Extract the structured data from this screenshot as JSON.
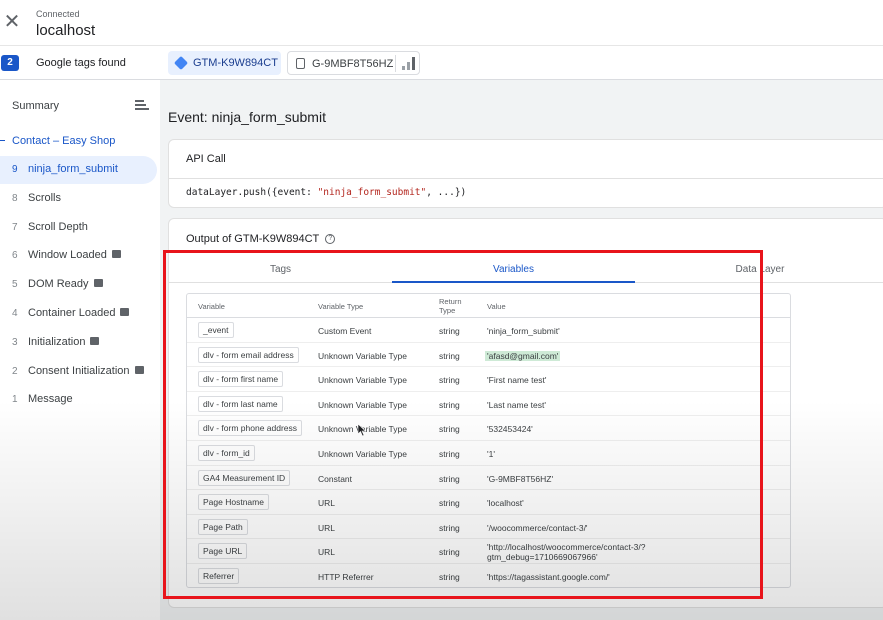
{
  "header": {
    "status": "Connected",
    "host": "localhost"
  },
  "tagbar": {
    "count": "2",
    "found_label": "Google tags found",
    "gtm_chip": "GTM-K9W894CT",
    "ga_chip": "G-9MBF8T56HZ"
  },
  "sidebar": {
    "summary": "Summary",
    "page_group": "Contact – Easy Shop",
    "events": [
      {
        "num": "9",
        "name": "ninja_form_submit",
        "icon": false
      },
      {
        "num": "8",
        "name": "Scrolls",
        "icon": false
      },
      {
        "num": "7",
        "name": "Scroll Depth",
        "icon": false
      },
      {
        "num": "6",
        "name": "Window Loaded",
        "icon": true
      },
      {
        "num": "5",
        "name": "DOM Ready",
        "icon": true
      },
      {
        "num": "4",
        "name": "Container Loaded",
        "icon": true
      },
      {
        "num": "3",
        "name": "Initialization",
        "icon": true
      },
      {
        "num": "2",
        "name": "Consent Initialization",
        "icon": true
      },
      {
        "num": "1",
        "name": "Message",
        "icon": false
      }
    ]
  },
  "main": {
    "event_title": "Event: ninja_form_submit",
    "api_card": {
      "title": "API Call",
      "code_prefix": "dataLayer.push({event: ",
      "code_string": "\"ninja_form_submit\"",
      "code_suffix": ", ...})"
    },
    "output": {
      "title": "Output of GTM-K9W894CT",
      "tabs": [
        "Tags",
        "Variables",
        "Data Layer"
      ],
      "active_tab": "Variables"
    },
    "table": {
      "headers": [
        "Variable",
        "Variable Type",
        "Return",
        "Type",
        "Value"
      ],
      "rows": [
        {
          "name": "_event",
          "type": "Custom Event",
          "ret": "string",
          "value": "'ninja_form_submit'"
        },
        {
          "name": "dlv - form email address",
          "type": "Unknown Variable Type",
          "ret": "string",
          "value": "'afasd@gmail.com'"
        },
        {
          "name": "dlv - form first name",
          "type": "Unknown Variable Type",
          "ret": "string",
          "value": "'First name test'"
        },
        {
          "name": "dlv - form last name",
          "type": "Unknown Variable Type",
          "ret": "string",
          "value": "'Last name test'"
        },
        {
          "name": "dlv - form phone address",
          "type": "Unknown Variable Type",
          "ret": "string",
          "value": "'532453424'"
        },
        {
          "name": "dlv - form_id",
          "type": "Unknown Variable Type",
          "ret": "string",
          "value": "'1'"
        },
        {
          "name": "GA4 Measurement ID",
          "type": "Constant",
          "ret": "string",
          "value": "'G-9MBF8T56HZ'"
        },
        {
          "name": "Page Hostname",
          "type": "URL",
          "ret": "string",
          "value": "'localhost'"
        },
        {
          "name": "Page Path",
          "type": "URL",
          "ret": "string",
          "value": "'/woocommerce/contact-3/'"
        },
        {
          "name": "Page URL",
          "type": "URL",
          "ret": "string",
          "value": "'http://localhost/woocommerce/contact-3/?gtm_debug=1710669067966'"
        },
        {
          "name": "Referrer",
          "type": "HTTP Referrer",
          "ret": "string",
          "value": "'https://tagassistant.google.com/'"
        }
      ]
    }
  },
  "colors": {
    "accent": "#1a57c8",
    "annotation": "#e8141b",
    "highlight": "#ceead6"
  }
}
